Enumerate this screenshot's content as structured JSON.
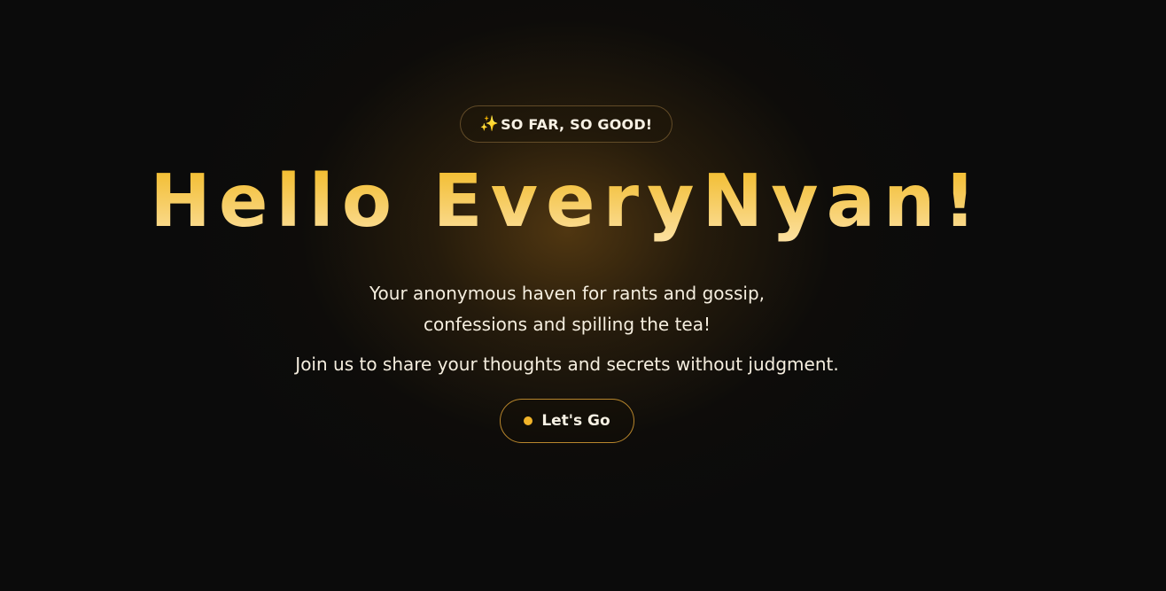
{
  "badge": {
    "icon": "sparkles-icon",
    "icon_glyph": "✨",
    "text": "SO FAR, SO GOOD!"
  },
  "hero": {
    "title": "Hello EveryNyan!",
    "tagline_line1": "Your anonymous haven for rants and gossip,",
    "tagline_line2": "confessions and spilling the tea!",
    "subline": "Join us to share your thoughts and secrets without judgment."
  },
  "cta": {
    "label": "Let's Go",
    "icon": "dot-icon"
  },
  "colors": {
    "accent": "#f1b42a",
    "background": "#0b0b0b",
    "text": "#f5eedf"
  }
}
